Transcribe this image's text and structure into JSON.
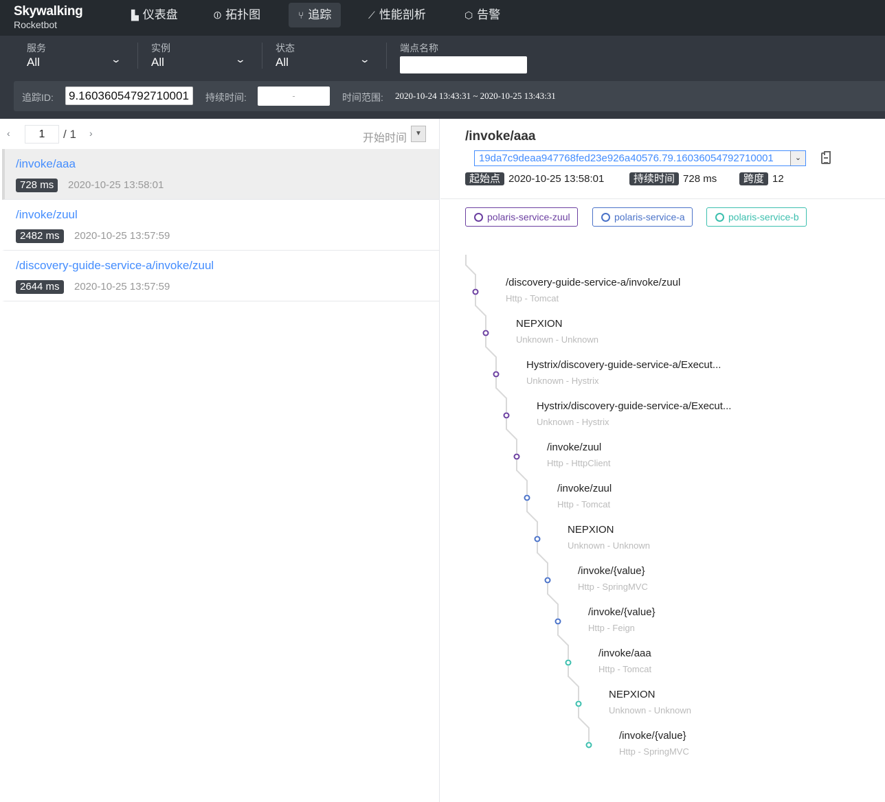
{
  "nav": {
    "brand": "Skywalking",
    "brand_sub": "Rocketbot",
    "items": [
      {
        "label": "仪表盘",
        "icon": "chart-icon"
      },
      {
        "label": "拓扑图",
        "icon": "topology-icon"
      },
      {
        "label": "追踪",
        "icon": "trace-icon"
      },
      {
        "label": "性能剖析",
        "icon": "profile-icon"
      },
      {
        "label": "告警",
        "icon": "alarm-icon"
      }
    ]
  },
  "filters": {
    "service_label": "服务",
    "service_value": "All",
    "instance_label": "实例",
    "instance_value": "All",
    "status_label": "状态",
    "status_value": "All",
    "endpoint_label": "端点名称",
    "endpoint_value": "",
    "trace_id_label": "追踪ID:",
    "trace_id_value": "9.16036054792710001",
    "duration_label": "持续时间:",
    "duration_value": "-",
    "time_range_label": "时间范围:",
    "time_range_value": "2020-10-24 13:43:31 ~ 2020-10-25 13:43:31"
  },
  "pager": {
    "page": "1",
    "total": "/ 1",
    "sort_label": "开始时间"
  },
  "traces": [
    {
      "name": "/invoke/aaa",
      "duration": "728 ms",
      "time": "2020-10-25 13:58:01"
    },
    {
      "name": "/invoke/zuul",
      "duration": "2482 ms",
      "time": "2020-10-25 13:57:59"
    },
    {
      "name": "/discovery-guide-service-a/invoke/zuul",
      "duration": "2644 ms",
      "time": "2020-10-25 13:57:59"
    }
  ],
  "detail": {
    "title": "/invoke/aaa",
    "trace_id": "19da7c9deaa947768fed23e926a40576.79.16036054792710001",
    "start_label": "起始点",
    "start_value": "2020-10-25 13:58:01",
    "duration_label": "持续时间",
    "duration_value": "728 ms",
    "span_label": "跨度",
    "span_value": "12"
  },
  "services": [
    {
      "name": "polaris-service-zuul",
      "color": "#6b3fa0"
    },
    {
      "name": "polaris-service-a",
      "color": "#4a72c8"
    },
    {
      "name": "polaris-service-b",
      "color": "#3cbfae"
    }
  ],
  "spans": [
    {
      "name": "/discovery-guide-service-a/invoke/zuul",
      "sub": "Http - Tomcat",
      "service": 0
    },
    {
      "name": "NEPXION",
      "sub": "Unknown - Unknown",
      "service": 0
    },
    {
      "name": "Hystrix/discovery-guide-service-a/Execut...",
      "sub": "Unknown - Hystrix",
      "service": 0
    },
    {
      "name": "Hystrix/discovery-guide-service-a/Execut...",
      "sub": "Unknown - Hystrix",
      "service": 0
    },
    {
      "name": "/invoke/zuul",
      "sub": "Http - HttpClient",
      "service": 0
    },
    {
      "name": "/invoke/zuul",
      "sub": "Http - Tomcat",
      "service": 1
    },
    {
      "name": "NEPXION",
      "sub": "Unknown - Unknown",
      "service": 1
    },
    {
      "name": "/invoke/{value}",
      "sub": "Http - SpringMVC",
      "service": 1
    },
    {
      "name": "/invoke/{value}",
      "sub": "Http - Feign",
      "service": 1
    },
    {
      "name": "/invoke/aaa",
      "sub": "Http - Tomcat",
      "service": 2
    },
    {
      "name": "NEPXION",
      "sub": "Unknown - Unknown",
      "service": 2
    },
    {
      "name": "/invoke/{value}",
      "sub": "Http - SpringMVC",
      "service": 2
    }
  ]
}
